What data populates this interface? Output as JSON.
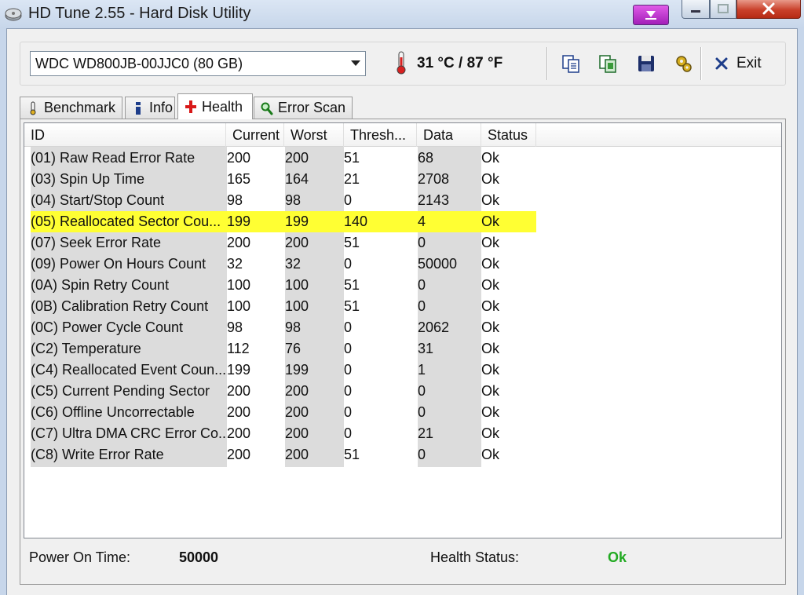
{
  "window": {
    "title": "HD Tune 2.55 - Hard Disk Utility"
  },
  "toolbar": {
    "drive": "WDC WD800JB-00JJC0 (80 GB)",
    "temperature": "31 °C / 87 °F",
    "exit_label": "Exit",
    "icons": [
      "copy-text-icon",
      "copy-screenshot-icon",
      "save-icon",
      "options-icon"
    ]
  },
  "tabs": [
    {
      "label": "Benchmark",
      "icon": "benchmark-icon"
    },
    {
      "label": "Info",
      "icon": "info-icon"
    },
    {
      "label": "Health",
      "icon": "health-cross-icon",
      "active": true
    },
    {
      "label": "Error Scan",
      "icon": "magnifier-icon"
    }
  ],
  "table": {
    "columns": [
      "ID",
      "Current",
      "Worst",
      "Thresh...",
      "Data",
      "Status"
    ],
    "rows": [
      [
        "(01) Raw Read Error Rate",
        "200",
        "200",
        "51",
        "68",
        "Ok"
      ],
      [
        "(03) Spin Up Time",
        "165",
        "164",
        "21",
        "2708",
        "Ok"
      ],
      [
        "(04) Start/Stop Count",
        "98",
        "98",
        "0",
        "2143",
        "Ok"
      ],
      [
        "(05) Reallocated Sector Cou...",
        "199",
        "199",
        "140",
        "4",
        "Ok"
      ],
      [
        "(07) Seek Error Rate",
        "200",
        "200",
        "51",
        "0",
        "Ok"
      ],
      [
        "(09) Power On Hours Count",
        "32",
        "32",
        "0",
        "50000",
        "Ok"
      ],
      [
        "(0A) Spin Retry Count",
        "100",
        "100",
        "51",
        "0",
        "Ok"
      ],
      [
        "(0B) Calibration Retry Count",
        "100",
        "100",
        "51",
        "0",
        "Ok"
      ],
      [
        "(0C) Power Cycle Count",
        "98",
        "98",
        "0",
        "2062",
        "Ok"
      ],
      [
        "(C2) Temperature",
        "112",
        "76",
        "0",
        "31",
        "Ok"
      ],
      [
        "(C4) Reallocated Event Coun...",
        "199",
        "199",
        "0",
        "1",
        "Ok"
      ],
      [
        "(C5) Current Pending Sector",
        "200",
        "200",
        "0",
        "0",
        "Ok"
      ],
      [
        "(C6) Offline Uncorrectable",
        "200",
        "200",
        "0",
        "0",
        "Ok"
      ],
      [
        "(C7) Ultra DMA CRC Error Co...",
        "200",
        "200",
        "0",
        "21",
        "Ok"
      ],
      [
        "(C8) Write Error Rate",
        "200",
        "200",
        "51",
        "0",
        "Ok"
      ]
    ],
    "highlight_row": 3,
    "highlight_color": "#ffff33"
  },
  "footer": {
    "power_on_label": "Power On Time:",
    "power_on_value": "50000",
    "health_label": "Health Status:",
    "health_value": "Ok",
    "health_color": "#22aa22"
  }
}
